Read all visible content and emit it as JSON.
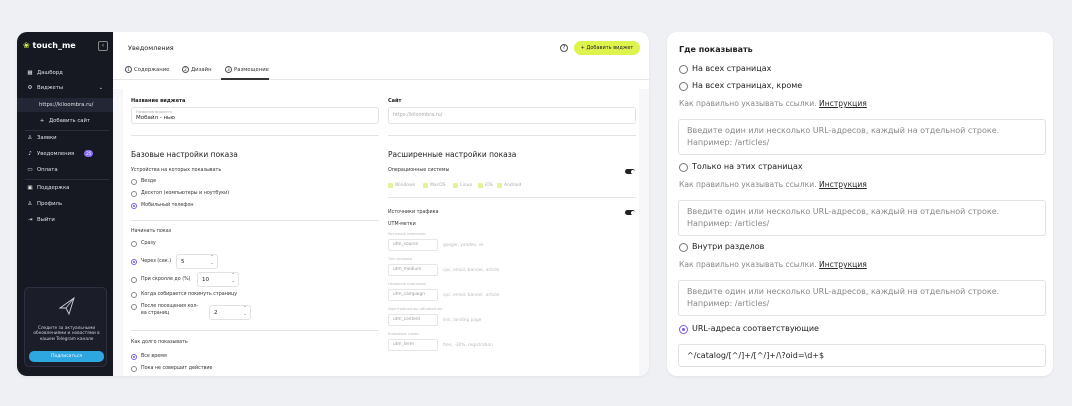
{
  "sidebar": {
    "logo": "touch_me",
    "collapse_icon": "chevron-left-icon",
    "items": [
      {
        "label": "Дашборд",
        "icon": "dashboard-icon"
      },
      {
        "label": "Виджеты",
        "icon": "widgets-icon"
      },
      {
        "label": "https://kiloombra.ru/"
      },
      {
        "label": "Добавить сайт",
        "icon": "plus-icon"
      },
      {
        "label": "Заявки",
        "icon": "user-icon"
      },
      {
        "label": "Уведомления",
        "icon": "bell-icon",
        "badge": "25"
      },
      {
        "label": "Оплата",
        "icon": "card-icon"
      },
      {
        "label": "Поддержка",
        "icon": "support-icon"
      },
      {
        "label": "Профиль",
        "icon": "profile-icon"
      },
      {
        "label": "Выйти",
        "icon": "logout-icon"
      }
    ],
    "promo": {
      "text": "Следите за актуальными обновлениями и новостями в нашем Telegram канале",
      "button": "Подписаться"
    }
  },
  "header": {
    "title": "Уведомления",
    "add_button": "Добавить виджет"
  },
  "tabs": [
    {
      "num": "1",
      "label": "Содержание"
    },
    {
      "num": "2",
      "label": "Дизайн"
    },
    {
      "num": "3",
      "label": "Размещение"
    }
  ],
  "form": {
    "widget_name_label": "Название виджета",
    "widget_name_placeholder": "Название виджета",
    "widget_name_value": "Мобайл - нью",
    "site_label": "Сайт",
    "site_value": "https://kiloombra.ru/",
    "basic_title": "Базовые настройки показа",
    "devices_label": "Устройства на которых показывать",
    "devices": [
      {
        "label": "Везде",
        "selected": false
      },
      {
        "label": "Десктоп (компьютеры и ноутбуки)",
        "selected": false
      },
      {
        "label": "Мобильный телефон",
        "selected": true
      }
    ],
    "start_label": "Начинать показ",
    "start_options": [
      {
        "label": "Сразу",
        "selected": false
      },
      {
        "label": "Через (сек.)",
        "selected": true,
        "value": "5"
      },
      {
        "label": "При скролле до (%)",
        "selected": false,
        "value": "10"
      },
      {
        "label": "Когда собирается покинуть страницу",
        "selected": false
      },
      {
        "label": "После посещения кол-ва страниц",
        "selected": false,
        "value": "2"
      }
    ],
    "duration_label": "Как долго показывать",
    "duration_options": [
      {
        "label": "Все время",
        "selected": true
      },
      {
        "label": "Пока не совершит действие",
        "selected": false
      }
    ],
    "advanced_title": "Расширенные настройки показа",
    "os_label": "Операционные системы",
    "os": [
      "Windows",
      "MacOS",
      "Linux",
      "iOS",
      "Android"
    ],
    "traffic_label": "Источники трафика",
    "utm_label": "UTM-метки",
    "utm": [
      {
        "hint": "Источник кампании",
        "key": "utm_source",
        "example": "google, yandex, vk"
      },
      {
        "hint": "Тип трафика",
        "key": "utm_medium",
        "example": "cpc, email, banner, article"
      },
      {
        "hint": "Название кампании",
        "key": "utm_campaign",
        "example": "cpc, email, banner, article"
      },
      {
        "hint": "Идентификатор объявления",
        "key": "utm_content",
        "example": "link, landing page"
      },
      {
        "hint": "Ключевое слово",
        "key": "utm_term",
        "example": "free, -30%, registration"
      }
    ]
  },
  "placement": {
    "title": "Где показывать",
    "options": [
      {
        "label": "На всех страницах",
        "selected": false
      },
      {
        "label": "На всех страницах, кроме",
        "selected": false
      },
      {
        "label": "Только на этих страницах",
        "selected": false
      },
      {
        "label": "Внутри разделов",
        "selected": false
      },
      {
        "label": "URL-адреса соответствующие",
        "selected": true
      }
    ],
    "hint": "Как правильно указывать ссылки.",
    "hint_link": "Инструкция",
    "textarea_placeholder": "Введите один или несколько URL-адресов, каждый на отдельной строке. Например: /articles/",
    "regex_value": "^/catalog/[^/]+/[^/]+/\\?oid=\\d+$"
  }
}
